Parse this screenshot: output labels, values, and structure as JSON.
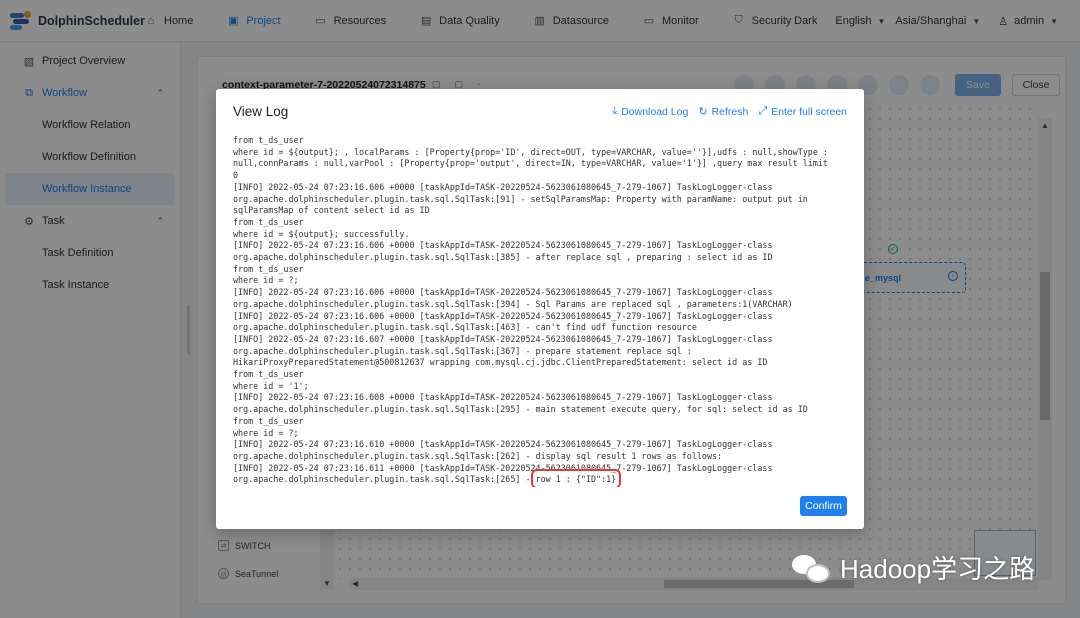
{
  "brand": {
    "name": "DolphinScheduler"
  },
  "topnav": {
    "items": [
      {
        "label": "Home",
        "icon": "home-icon",
        "active": false
      },
      {
        "label": "Project",
        "icon": "project-icon",
        "active": true
      },
      {
        "label": "Resources",
        "icon": "folder-icon",
        "active": false
      },
      {
        "label": "Data Quality",
        "icon": "clipboard-icon",
        "active": false
      },
      {
        "label": "Datasource",
        "icon": "database-icon",
        "active": false
      },
      {
        "label": "Monitor",
        "icon": "monitor-icon",
        "active": false
      },
      {
        "label": "Security",
        "icon": "shield-icon",
        "active": false
      }
    ],
    "theme": "Dark",
    "language": "English",
    "timezone": "Asia/Shanghai",
    "user": "admin"
  },
  "sidebar": {
    "items": [
      {
        "label": "Project Overview"
      },
      {
        "label": "Workflow"
      },
      {
        "label": "Workflow Relation"
      },
      {
        "label": "Workflow Definition"
      },
      {
        "label": "Workflow Instance"
      },
      {
        "label": "Task"
      },
      {
        "label": "Task Definition"
      },
      {
        "label": "Task Instance"
      }
    ]
  },
  "workspace": {
    "title": "context-parameter-7-20220524072314875",
    "save_label": "Save",
    "close_label": "Close",
    "node_label": "e_mysql",
    "tools": [
      {
        "label": "SWITCH"
      },
      {
        "label": "SeaTunnel"
      }
    ]
  },
  "modal": {
    "title": "View Log",
    "download_label": "Download Log",
    "refresh_label": "Refresh",
    "fullscreen_label": "Enter full screen",
    "confirm_label": "Confirm",
    "log_text": "from t_ds_user\nwhere id = ${output}; , localParams : [Property{prop='ID', direct=OUT, type=VARCHAR, value=''}],udfs : null,showType :\nnull,connParams : null,varPool : [Property{prop='output', direct=IN, type=VARCHAR, value='1'}] ,query max result limit\n0\n[INFO] 2022-05-24 07:23:16.606 +0000 [taskAppId=TASK-20220524-5623061080645_7-279-1067] TaskLogLogger-class\norg.apache.dolphinscheduler.plugin.task.sql.SqlTask:[91] - setSqlParamsMap: Property with paramName: output put in\nsqlParamsMap of content select id as ID\nfrom t_ds_user\nwhere id = ${output}; successfully.\n[INFO] 2022-05-24 07:23:16.606 +0000 [taskAppId=TASK-20220524-5623061080645_7-279-1067] TaskLogLogger-class\norg.apache.dolphinscheduler.plugin.task.sql.SqlTask:[385] - after replace sql , preparing : select id as ID\nfrom t_ds_user\nwhere id = ?;\n[INFO] 2022-05-24 07:23:16.606 +0000 [taskAppId=TASK-20220524-5623061080645_7-279-1067] TaskLogLogger-class\norg.apache.dolphinscheduler.plugin.task.sql.SqlTask:[394] - Sql Params are replaced sql , parameters:1(VARCHAR)\n[INFO] 2022-05-24 07:23:16.606 +0000 [taskAppId=TASK-20220524-5623061080645_7-279-1067] TaskLogLogger-class\norg.apache.dolphinscheduler.plugin.task.sql.SqlTask:[463] - can't find udf function resource\n[INFO] 2022-05-24 07:23:16.607 +0000 [taskAppId=TASK-20220524-5623061080645_7-279-1067] TaskLogLogger-class\norg.apache.dolphinscheduler.plugin.task.sql.SqlTask:[367] - prepare statement replace sql :\nHikariProxyPreparedStatement@500812637 wrapping com.mysql.cj.jdbc.ClientPreparedStatement: select id as ID\nfrom t_ds_user\nwhere id = '1';\n[INFO] 2022-05-24 07:23:16.608 +0000 [taskAppId=TASK-20220524-5623061080645_7-279-1067] TaskLogLogger-class\norg.apache.dolphinscheduler.plugin.task.sql.SqlTask:[295] - main statement execute query, for sql: select id as ID\nfrom t_ds_user\nwhere id = ?;\n[INFO] 2022-05-24 07:23:16.610 +0000 [taskAppId=TASK-20220524-5623061080645_7-279-1067] TaskLogLogger-class\norg.apache.dolphinscheduler.plugin.task.sql.SqlTask:[262] - display sql result 1 rows as follows:\n[INFO] 2022-05-24 07:23:16.611 +0000 [taskAppId=TASK-20220524-5623061080645_7-279-1067] TaskLogLogger-class\norg.apache.dolphinscheduler.plugin.task.sql.SqlTask:[265] - ",
    "log_highlight": "row 1 : {\"ID\":1}"
  },
  "watermark": {
    "text": "Hadoop学习之路"
  },
  "colors": {
    "accent": "#2080f0",
    "highlight_box": "#e53935",
    "save_disabled": "#7fb3ed"
  }
}
